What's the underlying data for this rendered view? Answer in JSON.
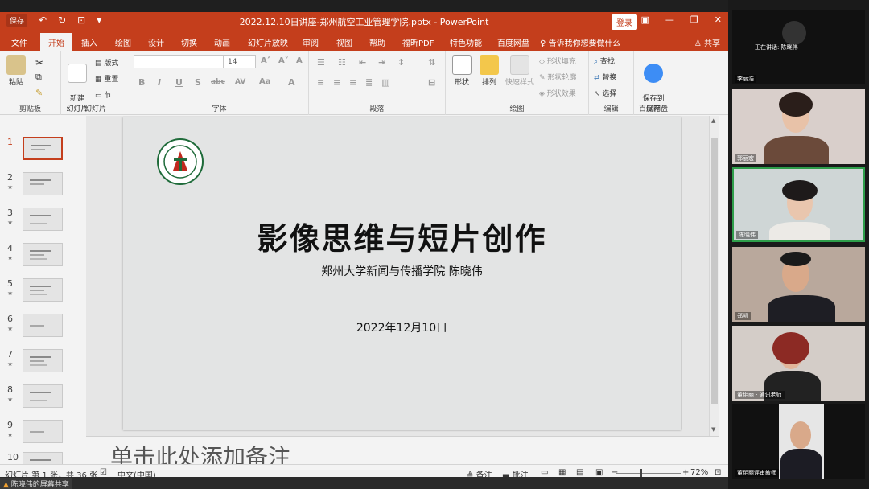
{
  "window": {
    "title": "2022.12.10日讲座-郑州航空工业管理学院.pptx - PowerPoint",
    "login_label": "登录",
    "qat_save": "保存"
  },
  "menu": {
    "tabs": [
      "文件",
      "开始",
      "插入",
      "绘图",
      "设计",
      "切换",
      "动画",
      "幻灯片放映",
      "审阅",
      "视图",
      "帮助",
      "福昕PDF",
      "特色功能",
      "百度网盘",
      "告诉我你想要做什么"
    ],
    "active_tab": "开始",
    "share": "共享"
  },
  "ribbon": {
    "clipboard": {
      "paste": "粘贴",
      "label": "剪贴板"
    },
    "slides": {
      "new_slide": "新建\n幻灯片",
      "layout": "版式",
      "reset": "重置",
      "section": "节",
      "label": "幻灯片"
    },
    "font": {
      "size": "14",
      "label": "字体",
      "buttons": [
        "B",
        "I",
        "U",
        "S",
        "abc",
        "AV",
        "Aa",
        "A"
      ]
    },
    "paragraph": {
      "label": "段落"
    },
    "drawing": {
      "shape": "形状",
      "arrange": "排列",
      "quick_style": "快速样式",
      "shape_fill": "形状填充",
      "shape_outline": "形状轮廓",
      "shape_effect": "形状效果",
      "label": "绘图"
    },
    "editing": {
      "find": "查找",
      "replace": "替换",
      "select": "选择",
      "label": "编辑"
    },
    "save": {
      "save_to": "保存到\n百度网盘",
      "label": "保存"
    }
  },
  "thumbnails": [
    "1",
    "2",
    "3",
    "4",
    "5",
    "6",
    "7",
    "8",
    "9",
    "10"
  ],
  "slide": {
    "title": "影像思维与短片创作",
    "subtitle": "郑州大学新闻与传播学院  陈晓伟",
    "date": "2022年12月10日",
    "logo_text": "ZHENGZHOU UNIVERSITY"
  },
  "notes_placeholder": "单击此处添加备注",
  "status": {
    "slide_info": "幻灯片 第 1 张，共 36 张",
    "language": "中文(中国)",
    "notes": "备注",
    "comments": "批注",
    "zoom": "72%"
  },
  "taskbar": {
    "sharing": "陈晓伟的屏幕共享"
  },
  "videos": [
    {
      "name": "李丽浩",
      "talking": "正在讲话: 陈晓伟"
    },
    {
      "name": "郭丽宏"
    },
    {
      "name": "陈晓伟"
    },
    {
      "name": "郑凯"
    },
    {
      "name": "董玥丽 · 通讯老师"
    },
    {
      "name": "董玥丽评审教师"
    }
  ],
  "colors": {
    "ppt_accent": "#c43e1c",
    "active_speaker": "#2e9e4a"
  }
}
